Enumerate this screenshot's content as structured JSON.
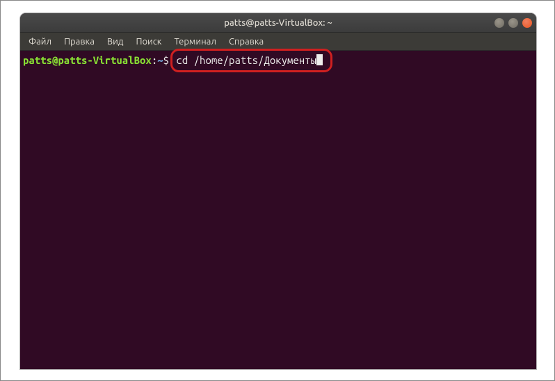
{
  "titlebar": {
    "title": "patts@patts-VirtualBox: ~"
  },
  "menubar": {
    "items": [
      {
        "label": "Файл"
      },
      {
        "label": "Правка"
      },
      {
        "label": "Вид"
      },
      {
        "label": "Поиск"
      },
      {
        "label": "Терминал"
      },
      {
        "label": "Справка"
      }
    ]
  },
  "terminal": {
    "prompt_user": "patts@patts-VirtualBox",
    "prompt_colon": ":",
    "prompt_path": "~",
    "prompt_symbol": "$",
    "command": "cd /home/patts/Документы"
  }
}
